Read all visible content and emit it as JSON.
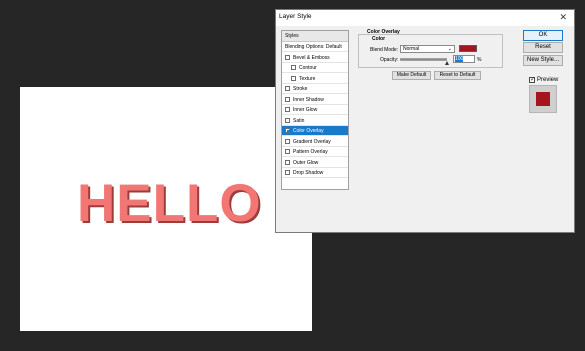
{
  "canvas": {
    "text": "HELLO",
    "text_color": "#f27774",
    "background": "#ffffff"
  },
  "dialog": {
    "title": "Layer Style",
    "styles_panel": {
      "header": "Styles",
      "items": [
        {
          "label": "Blending Options: Default",
          "checkbox": false,
          "checked": false,
          "selected": false
        },
        {
          "label": "Bevel & Emboss",
          "checkbox": true,
          "checked": false,
          "selected": false
        },
        {
          "label": "Contour",
          "checkbox": true,
          "checked": false,
          "selected": false,
          "indent": true
        },
        {
          "label": "Texture",
          "checkbox": true,
          "checked": false,
          "selected": false,
          "indent": true
        },
        {
          "label": "Stroke",
          "checkbox": true,
          "checked": false,
          "selected": false
        },
        {
          "label": "Inner Shadow",
          "checkbox": true,
          "checked": false,
          "selected": false
        },
        {
          "label": "Inner Glow",
          "checkbox": true,
          "checked": false,
          "selected": false
        },
        {
          "label": "Satin",
          "checkbox": true,
          "checked": false,
          "selected": false
        },
        {
          "label": "Color Overlay",
          "checkbox": true,
          "checked": true,
          "selected": true
        },
        {
          "label": "Gradient Overlay",
          "checkbox": true,
          "checked": false,
          "selected": false
        },
        {
          "label": "Pattern Overlay",
          "checkbox": true,
          "checked": false,
          "selected": false
        },
        {
          "label": "Outer Glow",
          "checkbox": true,
          "checked": false,
          "selected": false
        },
        {
          "label": "Drop Shadow",
          "checkbox": true,
          "checked": false,
          "selected": false
        }
      ]
    },
    "color_overlay": {
      "group_title": "Color Overlay",
      "subgroup_title": "Color",
      "blend_mode_label": "Blend Mode:",
      "blend_mode_value": "Normal",
      "overlay_color": "#a3151f",
      "opacity_label": "Opacity:",
      "opacity_value": "100",
      "opacity_fraction": 1.0,
      "opacity_unit": "%",
      "make_default": "Make Default",
      "reset_to_default": "Reset to Default"
    },
    "buttons": {
      "ok": "OK",
      "reset": "Reset",
      "new_style": "New Style..."
    },
    "preview": {
      "label": "Preview",
      "checked": true
    }
  }
}
